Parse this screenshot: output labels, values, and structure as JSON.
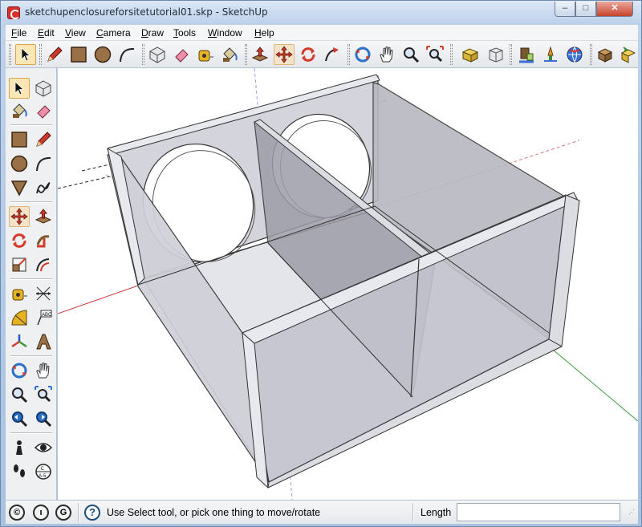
{
  "window": {
    "title": "sketchupenclosureforsitetutorial01.skp - SketchUp",
    "controls": {
      "minimize": "–",
      "maximize": "□",
      "close": "✕"
    }
  },
  "menu": [
    {
      "key": "F",
      "rest": "ile"
    },
    {
      "key": "E",
      "rest": "dit"
    },
    {
      "key": "V",
      "rest": "iew"
    },
    {
      "key": "C",
      "rest": "amera"
    },
    {
      "key": "D",
      "rest": "raw"
    },
    {
      "key": "T",
      "rest": "ools"
    },
    {
      "key": "W",
      "rest": "indow"
    },
    {
      "key": "H",
      "rest": "elp"
    }
  ],
  "toolbar_tools": [
    "select-tool",
    "pencil-tool",
    "rectangle-tool",
    "circle-tool",
    "arc-tool",
    "make-component-tool",
    "eraser-tool",
    "tape-measure-tool",
    "paint-bucket-tool",
    "push-pull-tool",
    "move-tool",
    "rotate-tool",
    "follow-me-tool",
    "orbit-tool",
    "pan-tool",
    "zoom-tool",
    "zoom-extents-tool",
    "get-models-tool",
    "share-model-tool",
    "share-component-tool",
    "place-model-tool",
    "geo-location-tool",
    "warehouse-tool",
    "extension-tool"
  ],
  "selected_tool": "select-tool",
  "status": {
    "message": "Use Select tool, or pick one thing to move/rotate",
    "length_label": "Length",
    "length_value": "",
    "icons": [
      "geo-icon",
      "credit-icon",
      "google-icon"
    ],
    "icon_letters": [
      "©",
      "ı",
      "G"
    ]
  },
  "colors": {
    "accent_red_axis": "#cc3a3a",
    "accent_green_axis": "#3a9a3a",
    "accent_blue_axis": "#3a3acc",
    "model_face": "#dcdde4",
    "model_shadow": "#9a9ba6"
  }
}
